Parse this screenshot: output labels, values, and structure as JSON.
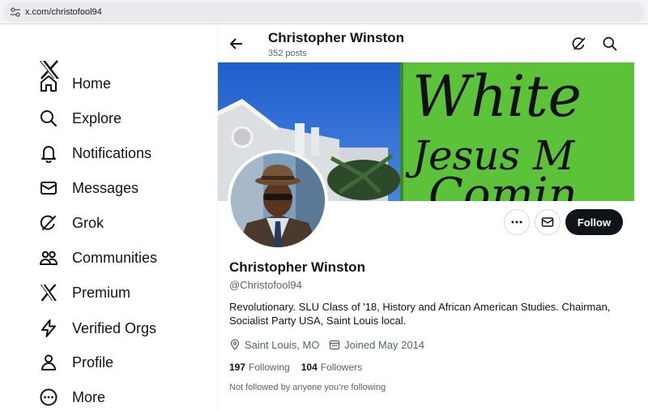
{
  "browser": {
    "url": "x.com/christofool94"
  },
  "sidebar": {
    "items": [
      {
        "label": "Home",
        "icon": "home-icon"
      },
      {
        "label": "Explore",
        "icon": "search-icon"
      },
      {
        "label": "Notifications",
        "icon": "bell-icon"
      },
      {
        "label": "Messages",
        "icon": "envelope-icon"
      },
      {
        "label": "Grok",
        "icon": "grok-icon"
      },
      {
        "label": "Communities",
        "icon": "people-icon"
      },
      {
        "label": "Premium",
        "icon": "x-logo-icon"
      },
      {
        "label": "Verified Orgs",
        "icon": "lightning-icon"
      },
      {
        "label": "Profile",
        "icon": "person-icon"
      },
      {
        "label": "More",
        "icon": "more-circle-icon"
      }
    ]
  },
  "header": {
    "name": "Christopher Winston",
    "posts": "352 posts"
  },
  "banner": {
    "sign_lines": [
      "White",
      "Jesus M",
      "Comin"
    ]
  },
  "actions": {
    "follow_label": "Follow"
  },
  "profile": {
    "name": "Christopher Winston",
    "handle": "@Christofool94",
    "bio": "Revolutionary. SLU Class of '18, History and African American Studies. Chairman, Socialist Party USA, Saint Louis local.",
    "location": "Saint Louis, MO",
    "joined": "Joined May 2014",
    "following_count": "197",
    "following_label": "Following",
    "followers_count": "104",
    "followers_label": "Followers",
    "not_followed": "Not followed by anyone you’re following"
  },
  "colors": {
    "text": "#0f1419",
    "secondary": "#536471",
    "border": "#cfd9de",
    "sign_green": "#5cc23a",
    "sky_blue": "#2f6fd6"
  }
}
